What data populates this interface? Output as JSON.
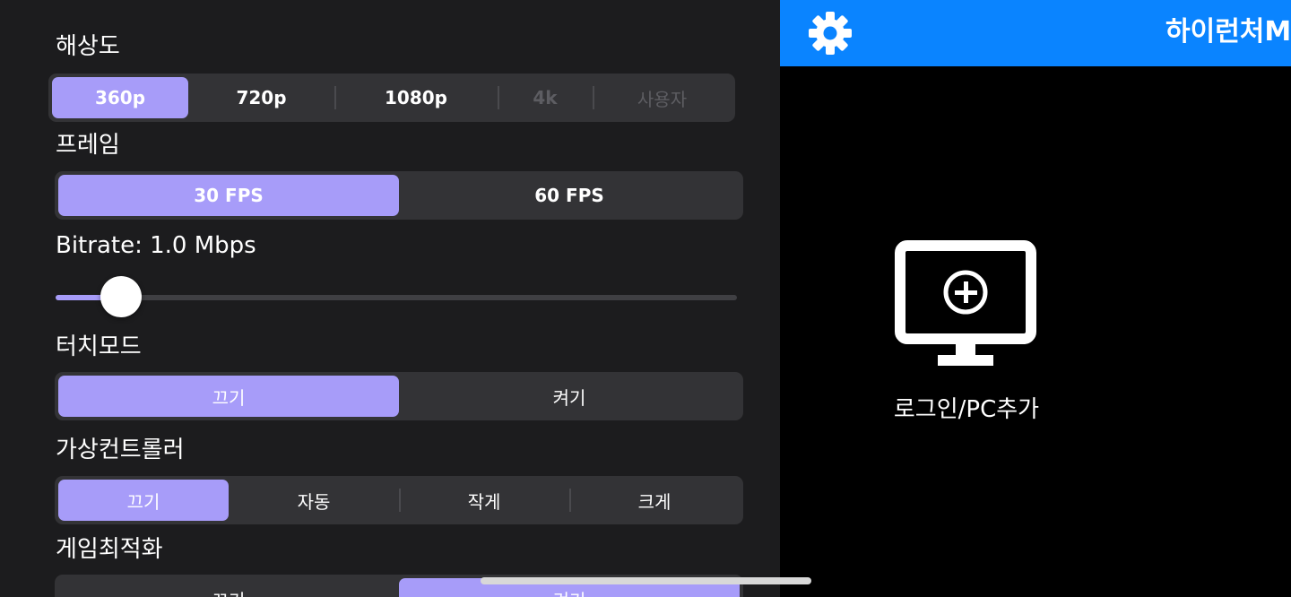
{
  "settings": {
    "resolution": {
      "label": "해상도",
      "options": [
        "360p",
        "720p",
        "1080p",
        "4k",
        "사용자"
      ],
      "selected": "360p",
      "disabled": [
        "4k",
        "사용자"
      ]
    },
    "frame": {
      "label": "프레임",
      "options": [
        "30 FPS",
        "60 FPS"
      ],
      "selected": "30 FPS"
    },
    "bitrate": {
      "label": "Bitrate: 1.0 Mbps",
      "value_fraction": 0.07
    },
    "touch_mode": {
      "label": "터치모드",
      "options": [
        "끄기",
        "켜기"
      ],
      "selected": "끄기"
    },
    "virtual_controller": {
      "label": "가상컨트롤러",
      "options": [
        "끄기",
        "자동",
        "작게",
        "크게"
      ],
      "selected": "끄기"
    },
    "game_optimization": {
      "label": "게임최적화",
      "options": [
        "끄기",
        "켜기"
      ],
      "selected": "켜기"
    }
  },
  "app": {
    "title": "하이런처M",
    "settings_icon": "gear-icon",
    "add_pc_icon": "monitor-plus-icon",
    "add_pc_label": "로그인/PC추가"
  },
  "colors": {
    "accent": "#a79cf9",
    "header": "#0a84ff",
    "panel_bg": "#1c1c1e",
    "segment_bg": "#333336"
  }
}
